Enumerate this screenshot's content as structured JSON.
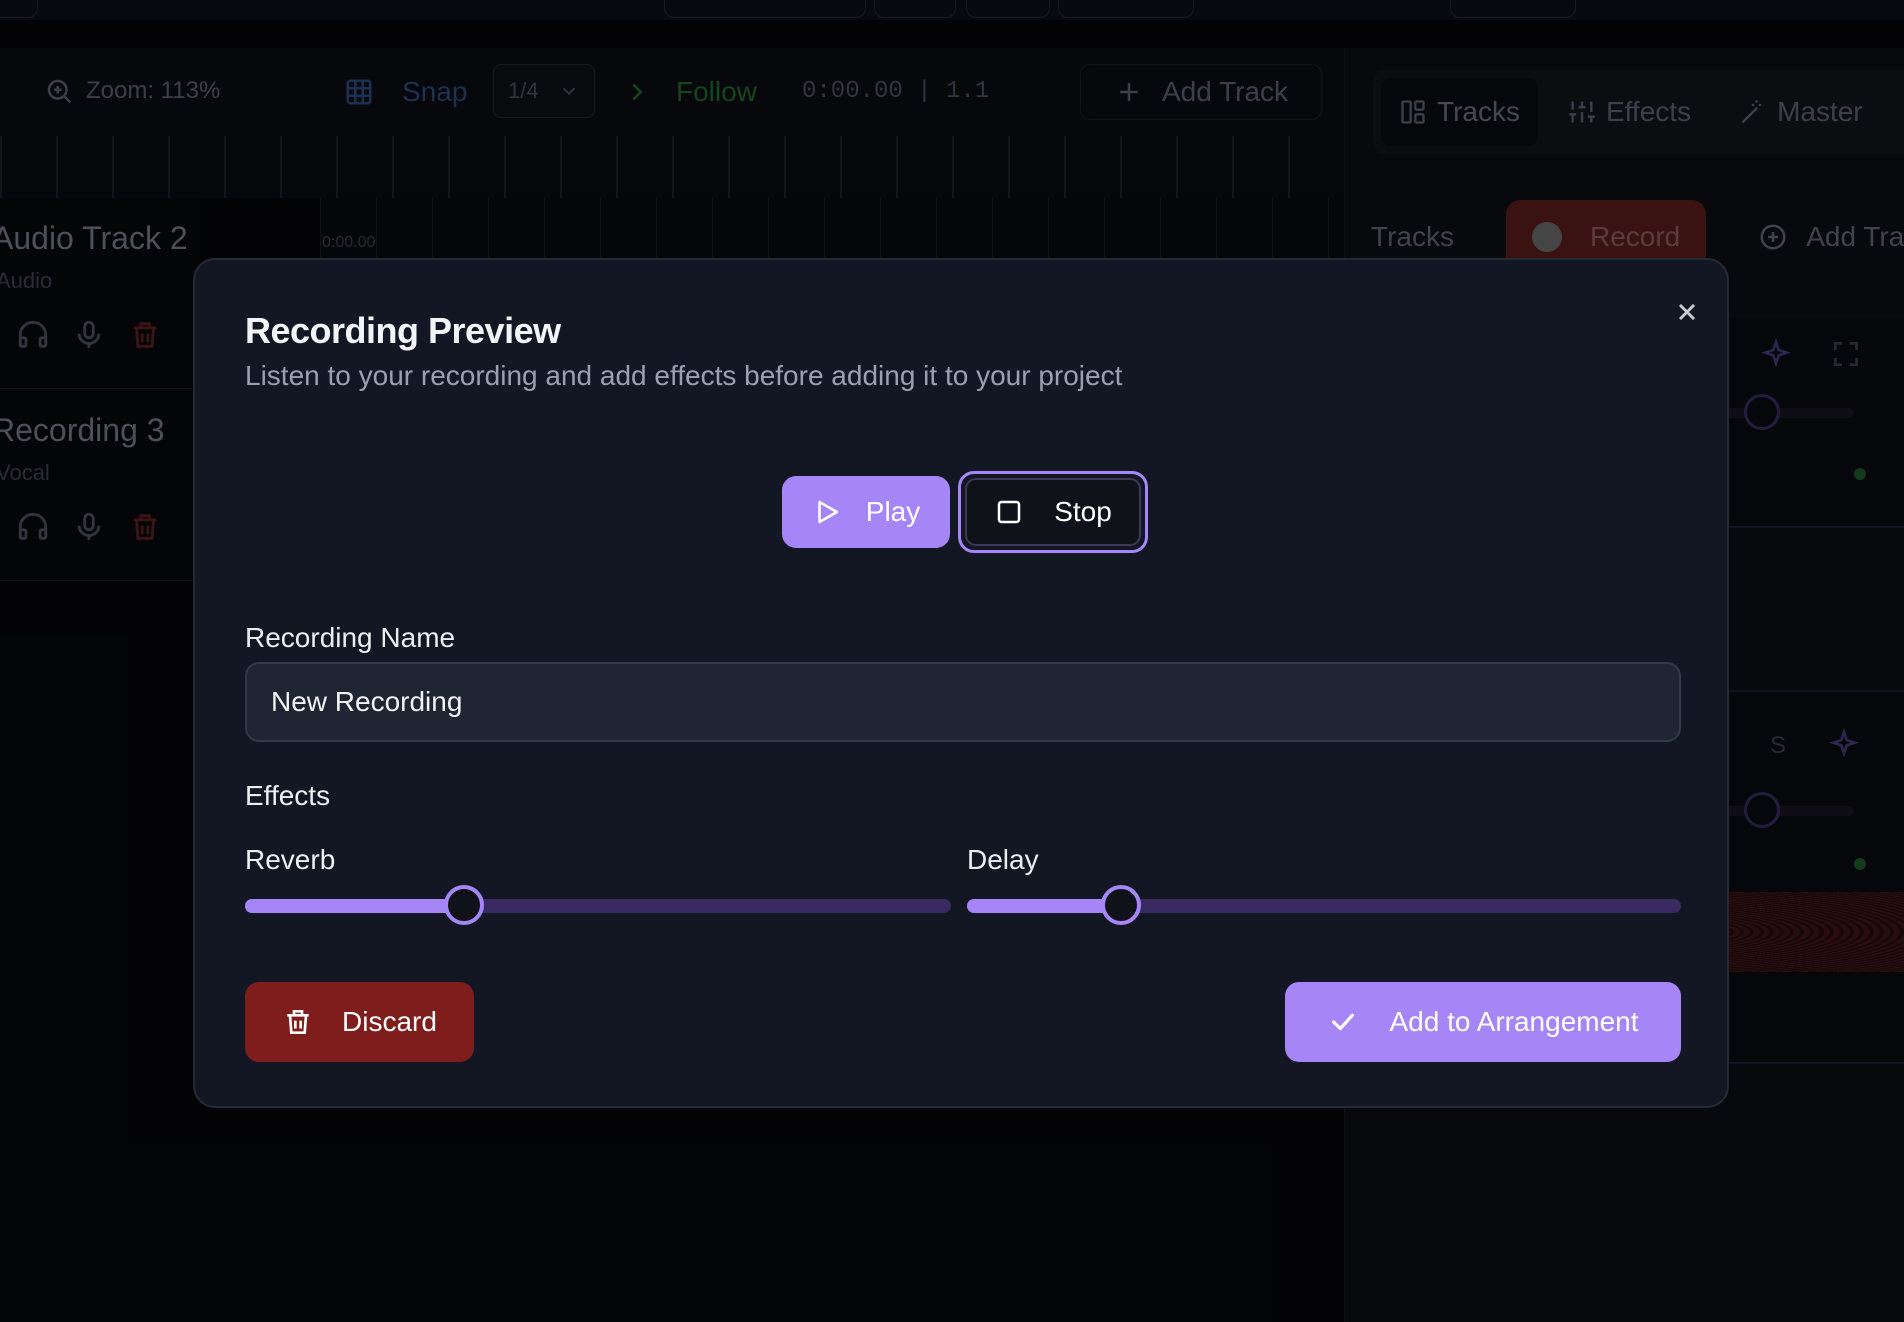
{
  "toolbar": {
    "zoom_label": "Zoom: 113%",
    "snap_label": "Snap",
    "snap_value": "1/4",
    "follow_label": "Follow",
    "time_readout": "0:00.00 | 1.1",
    "add_track_label": "Add Track"
  },
  "timeline": {
    "start_time": "0:00.00"
  },
  "tracks": [
    {
      "name": "Audio Track 2",
      "type": "Audio"
    },
    {
      "name": "Recording 3",
      "type": "Vocal"
    }
  ],
  "right_panel": {
    "tabs": [
      {
        "label": "Tracks",
        "icon": "layout-icon"
      },
      {
        "label": "Effects",
        "icon": "sliders-icon"
      },
      {
        "label": "Master",
        "icon": "wand-icon"
      }
    ],
    "subheader": {
      "title": "Tracks",
      "record_label": "Record",
      "add_track_label": "Add Track"
    }
  },
  "modal": {
    "title": "Recording Preview",
    "subtitle": "Listen to your recording and add effects before adding it to your project",
    "play_label": "Play",
    "stop_label": "Stop",
    "name_label": "Recording Name",
    "name_value": "New Recording",
    "effects_label": "Effects",
    "reverb": {
      "label": "Reverb",
      "value": 0.31
    },
    "delay": {
      "label": "Delay",
      "value": 0.215
    },
    "discard_label": "Discard",
    "add_label": "Add to Arrangement"
  },
  "colors": {
    "accent": "#a686f6",
    "danger": "#7f1d1d",
    "modal_bg": "#121723",
    "follow_green": "#1f6a2c",
    "snap_blue": "#2b4a7a"
  }
}
